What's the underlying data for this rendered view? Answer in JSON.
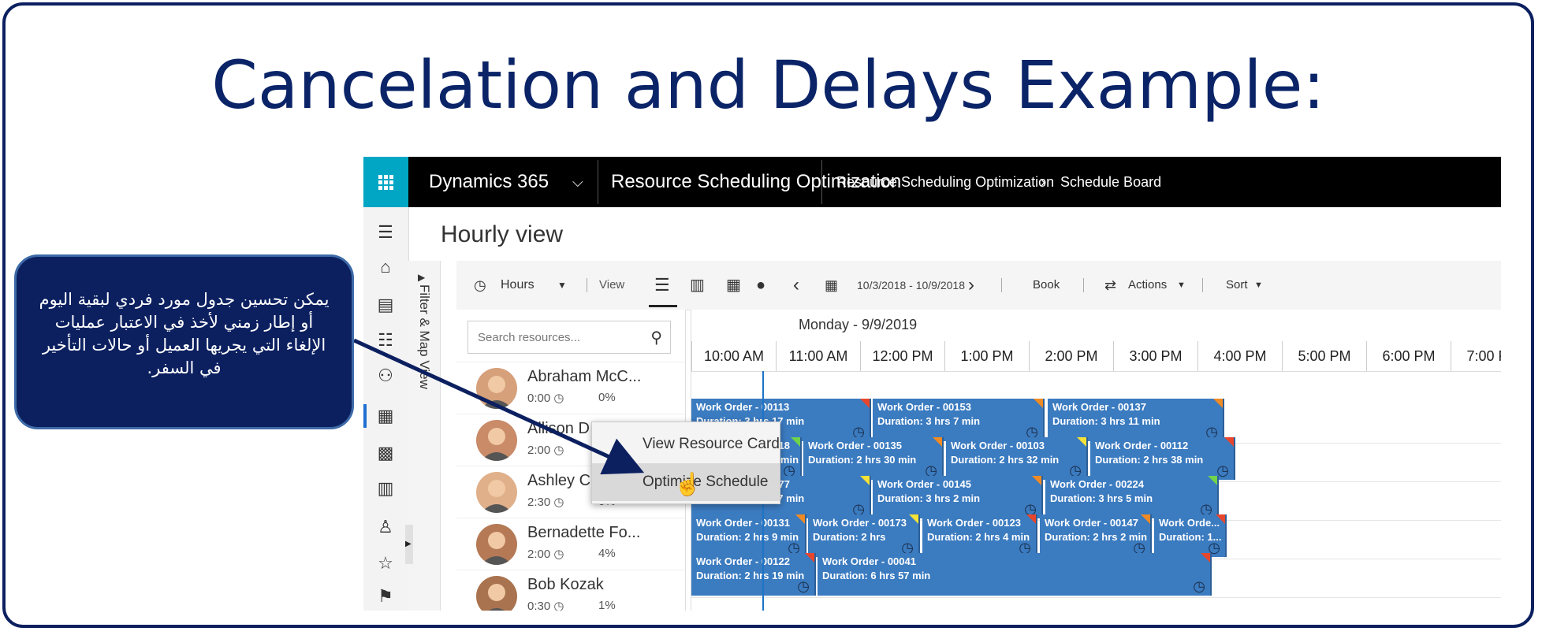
{
  "slide": {
    "title": "Cancelation and Delays Example:",
    "callout_text": "يمكن تحسين جدول مورد فردي لبقية اليوم أو إطار زمني لأخذ في الاعتبار عمليات الإلغاء التي يجريها العميل أو حالات التأخير في السفر."
  },
  "app": {
    "product": "Dynamics 365",
    "module": "Resource Scheduling Optimization",
    "breadcrumb": [
      "Resource Scheduling Optimization",
      "Schedule Board"
    ],
    "page_title": "Hourly view",
    "filter_pane_label": "Filter & Map View"
  },
  "toolbar": {
    "hours_label": "Hours",
    "view_label": "View",
    "date_range": "10/3/2018 - 10/9/2018",
    "book_label": "Book",
    "actions_label": "Actions",
    "sort_label": "Sort"
  },
  "search": {
    "placeholder": "Search resources..."
  },
  "resources": [
    {
      "name": "Abraham McC...",
      "hours": "0:00",
      "pct": "0%"
    },
    {
      "name": "Allison D",
      "hours": "2:00",
      "pct": ""
    },
    {
      "name": "Ashley C",
      "hours": "2:30",
      "pct": "0%"
    },
    {
      "name": "Bernadette Fo...",
      "hours": "2:00",
      "pct": "4%"
    },
    {
      "name": "Bob Kozak",
      "hours": "0:30",
      "pct": "1%"
    }
  ],
  "board": {
    "day_label": "Monday - 9/9/2019",
    "hours": [
      "10:00 AM",
      "11:00 AM",
      "12:00 PM",
      "1:00 PM",
      "2:00 PM",
      "3:00 PM",
      "4:00 PM",
      "5:00 PM",
      "6:00 PM",
      "7:00 PM"
    ],
    "lanes": [
      [
        {
          "title": "Work Order - 00113",
          "duration": "Duration: 3 hrs 17 min",
          "flag": "#e8462c"
        },
        {
          "title": "Work Order - 00153",
          "duration": "Duration: 3 hrs 7 min",
          "flag": "#f08a24"
        },
        {
          "title": "Work Order - 00137",
          "duration": "Duration: 3 hrs 11 min",
          "flag": "#f08a24"
        }
      ],
      [
        {
          "title": "Work Order - 00218",
          "duration": "Duration: 2 hrs 4 min",
          "flag": "#6fd34c"
        },
        {
          "title": "Work Order - 00135",
          "duration": "Duration: 2 hrs 30 min",
          "flag": "#f08a24"
        },
        {
          "title": "Work Order - 00103",
          "duration": "Duration: 2 hrs 32 min",
          "flag": "#f5e236"
        },
        {
          "title": "Work Order - 00112",
          "duration": "Duration: 2 hrs 38 min",
          "flag": "#e8462c"
        }
      ],
      [
        {
          "title": "Work Order - 00177",
          "duration": "Duration: 3 hrs 17 min",
          "flag": "#f5e236"
        },
        {
          "title": "Work Order - 00145",
          "duration": "Duration: 3 hrs 2 min",
          "flag": "#f08a24"
        },
        {
          "title": "Work Order - 00224",
          "duration": "Duration: 3 hrs 5 min",
          "flag": "#6fd34c"
        }
      ],
      [
        {
          "title": "Work Order - 00131",
          "duration": "Duration: 2 hrs 9 min",
          "flag": "#f08a24"
        },
        {
          "title": "Work Order - 00173",
          "duration": "Duration: 2 hrs",
          "flag": "#f5e236"
        },
        {
          "title": "Work Order - 00123",
          "duration": "Duration: 2 hrs 4 min",
          "flag": "#e8462c"
        },
        {
          "title": "Work Order - 00147",
          "duration": "Duration: 2 hrs 2 min",
          "flag": "#f08a24"
        },
        {
          "title": "Work Orde...",
          "duration": "Duration: 1...",
          "flag": "#e8462c"
        }
      ],
      [
        {
          "title": "Work Order - 00122",
          "duration": "Duration: 2 hrs 19 min",
          "flag": "#e8462c"
        },
        {
          "title": "Work Order - 00041",
          "duration": "Duration: 6 hrs 57 min",
          "flag": "#e8462c"
        }
      ]
    ]
  },
  "context_menu": {
    "items": [
      "View Resource Card",
      "Optimize Schedule"
    ],
    "highlighted": "Optimize Schedule"
  },
  "colors": {
    "title": "#0b2468",
    "callout_bg": "#0c2060",
    "topbar": "#000000",
    "waffle": "#00a6c4",
    "booking": "#3b7bc0",
    "now_line": "#1d74c7"
  }
}
